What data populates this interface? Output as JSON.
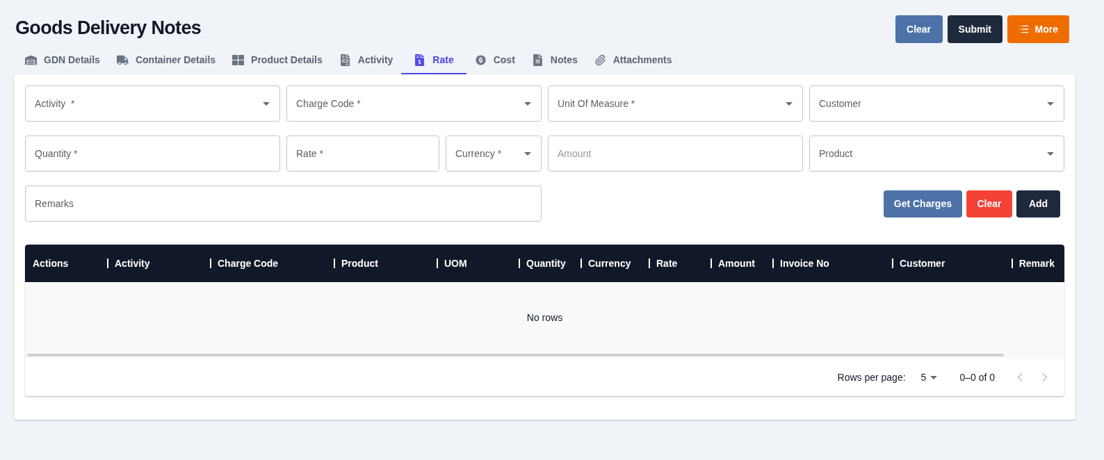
{
  "page": {
    "title": "Goods Delivery Notes"
  },
  "header_buttons": [
    {
      "label": "Clear",
      "kind": "secondary"
    },
    {
      "label": "Submit",
      "kind": "dark"
    },
    {
      "label": "More",
      "kind": "menu"
    }
  ],
  "tabs": [
    {
      "label": "GDN Details",
      "selected": false
    },
    {
      "label": "Container Details",
      "selected": false
    },
    {
      "label": "Product Details",
      "selected": false
    },
    {
      "label": "Activity",
      "selected": false
    },
    {
      "label": "Rate",
      "selected": true
    },
    {
      "label": "Cost",
      "selected": false
    },
    {
      "label": "Notes",
      "selected": false
    },
    {
      "label": "Attachments",
      "selected": false
    }
  ],
  "form_rows": [
    [
      {
        "placeholder": "Activity  *",
        "kind": "select",
        "disabled": false
      },
      {
        "placeholder": "Charge Code *",
        "kind": "select",
        "disabled": false
      },
      {
        "placeholder": "Unit Of Measure *",
        "kind": "select",
        "disabled": false
      },
      {
        "placeholder": "Customer",
        "kind": "select",
        "disabled": false
      }
    ],
    [
      {
        "placeholder": "Quantity *",
        "kind": "text",
        "disabled": false
      },
      {
        "placeholder": "Rate *",
        "kind": "text",
        "disabled": false
      },
      {
        "placeholder": "Currency *",
        "kind": "select",
        "disabled": false
      },
      {
        "placeholder": "Amount",
        "kind": "text",
        "disabled": true
      },
      {
        "placeholder": "Product",
        "kind": "select",
        "disabled": false
      }
    ],
    [
      {
        "placeholder": "Remarks",
        "kind": "text",
        "disabled": false
      }
    ]
  ],
  "form_buttons": [
    {
      "label": "Get Charges",
      "kind": "secondary"
    },
    {
      "label": "Clear",
      "kind": "danger"
    },
    {
      "label": "Add",
      "kind": "dark"
    }
  ],
  "table": {
    "columns": [
      "Actions",
      "Activity",
      "Charge Code",
      "Product",
      "UOM",
      "Quantity",
      "Currency",
      "Rate",
      "Amount",
      "Invoice No",
      "Customer",
      "Remark"
    ],
    "empty_message": "No rows",
    "pagination": {
      "rows_per_page_label": "Rows per page:",
      "rows_per_page": "5",
      "range": "0–0 of 0"
    }
  }
}
